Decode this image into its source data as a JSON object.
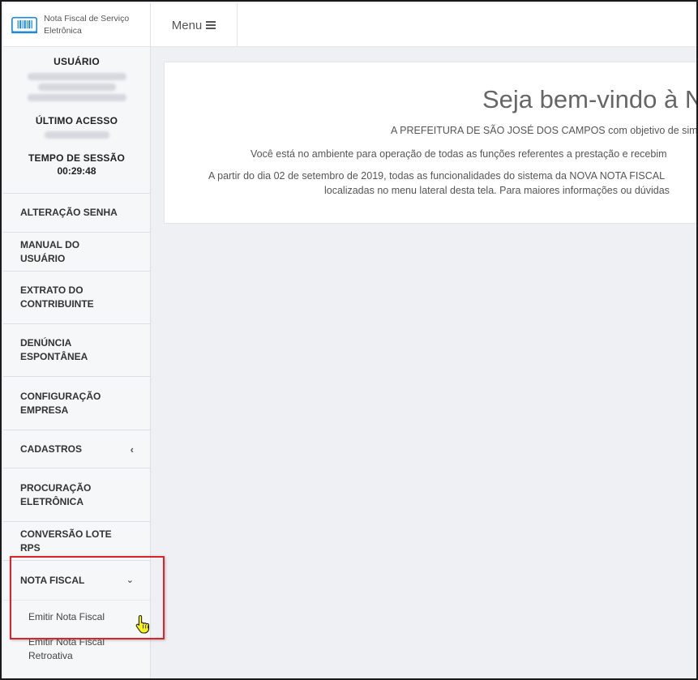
{
  "brand": {
    "title": "Nota Fiscal de Serviço Eletrônica"
  },
  "user_panel": {
    "user_label": "USUÁRIO",
    "last_access_label": "ÚLTIMO ACESSO",
    "session_label": "TEMPO DE SESSÃO",
    "session_time": "00:29:48"
  },
  "topbar": {
    "menu_label": "Menu"
  },
  "sidebar": {
    "items": [
      {
        "label": "ALTERAÇÃO SENHA"
      },
      {
        "label": "MANUAL DO USUÁRIO"
      },
      {
        "label": "EXTRATO DO CONTRIBUINTE"
      },
      {
        "label": "DENÚNCIA ESPONTÂNEA"
      },
      {
        "label": "CONFIGURAÇÃO EMPRESA"
      },
      {
        "label": "CADASTROS",
        "icon": "chevron-left-icon"
      },
      {
        "label": "PROCURAÇÃO ELETRÔNICA"
      },
      {
        "label": "CONVERSÃO LOTE RPS"
      },
      {
        "label": "NOTA FISCAL",
        "icon": "chevron-down-icon"
      }
    ],
    "sub_items": [
      {
        "label": "Emitir Nota Fiscal"
      },
      {
        "label": "Emitir Nota Fiscal Retroativa"
      }
    ]
  },
  "main": {
    "welcome": "Seja bem-vindo à NO",
    "line1": "A PREFEITURA DE SÃO JOSÉ DOS CAMPOS com objetivo de simp",
    "line2": "Você está no ambiente para operação de todas as funções referentes a prestação e recebim",
    "line3": "A partir do dia 02 de setembro de 2019, todas as funcionalidades do sistema da NOVA NOTA FISCAL",
    "line4": "localizadas no menu lateral desta tela. Para maiores informações ou dúvidas"
  },
  "colors": {
    "highlight": "#d9252a",
    "accent": "#1f8bd6"
  }
}
